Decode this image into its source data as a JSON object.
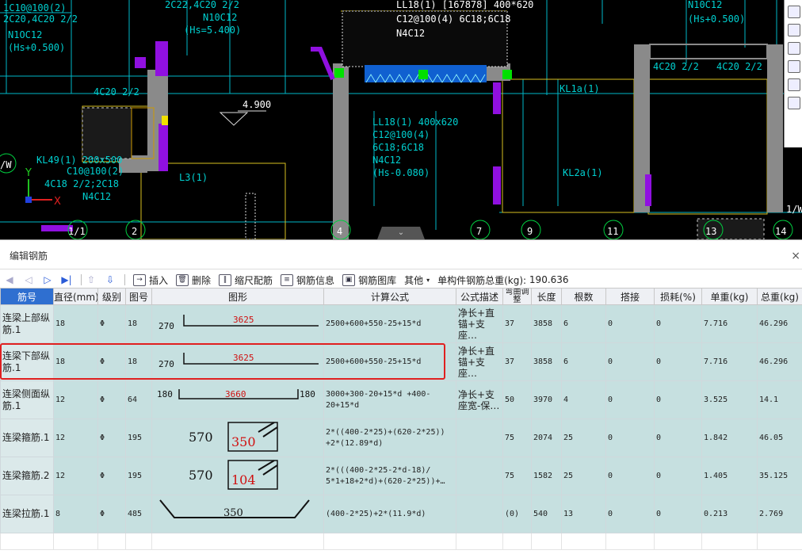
{
  "cad": {
    "annotations": [
      "N10C12",
      "(Hs=5.400)",
      "2C20,4C20 2/2",
      "N1OC12",
      "(Hs+0.500)",
      "LL18(1) [167878] 400*620",
      "C12@100(4) 6C18;6C18",
      "N4C12",
      "N10C12",
      "(Hs+0.500)",
      "4C20 2/2",
      "4C20 2/2",
      "4.900",
      "KL1a(1)",
      "KL49(1) 200x500",
      "C10@100(2)",
      "4C18 2/2;2C18",
      "N4C12",
      "L3(1)",
      "LL18(1) 400x620",
      "C12@100(4)",
      "6C18;6C18",
      "N4C12",
      "(Hs-0.080)",
      "XL1",
      "KL2a(1)",
      "4C22 2/2",
      "1/W",
      "/W"
    ],
    "axis_labels": [
      "1/1",
      "2",
      "4",
      "7",
      "9",
      "11",
      "13",
      "14"
    ],
    "y_axis": "Y",
    "x_axis": "X"
  },
  "panel": {
    "title": "编辑钢筋",
    "close": "×",
    "toolbar": {
      "insert": "插入",
      "delete": "删除",
      "scale_rebar": "缩尺配筋",
      "rebar_info": "钢筋信息",
      "rebar_library": "钢筋图库",
      "other": "其他",
      "total_weight_label": "单构件钢筋总重(kg):",
      "total_weight_value": "190.636"
    },
    "columns": [
      "筋号",
      "直径(mm)",
      "级别",
      "图号",
      "图形",
      "计算公式",
      "公式描述",
      "弯曲调整",
      "长度",
      "根数",
      "搭接",
      "损耗(%)",
      "单重(kg)",
      "总重(kg)"
    ],
    "rows": [
      {
        "name": "连梁上部纵筋.1",
        "dia": "18",
        "grade": "Φ",
        "fig": "18",
        "shape_left": "270",
        "shape_mid": "3625",
        "shape_right": "",
        "formula": "2500+600+550-25+15*d",
        "desc": "净长+直锚+支座…",
        "bend": "37",
        "length": "3858",
        "count": "6",
        "lap": "0",
        "loss": "0",
        "unit_w": "7.716",
        "total_w": "46.296"
      },
      {
        "name": "连梁下部纵筋.1",
        "dia": "18",
        "grade": "Φ",
        "fig": "18",
        "shape_left": "270",
        "shape_mid": "3625",
        "shape_right": "",
        "formula": "2500+600+550-25+15*d",
        "desc": "净长+直锚+支座…",
        "bend": "37",
        "length": "3858",
        "count": "6",
        "lap": "0",
        "loss": "0",
        "unit_w": "7.716",
        "total_w": "46.296"
      },
      {
        "name": "连梁侧面纵筋.1",
        "dia": "12",
        "grade": "Φ",
        "fig": "64",
        "shape_left": "180",
        "shape_mid": "3660",
        "shape_right": "180",
        "formula": "3000+300-20+15*d +400-20+15*d",
        "desc": "净长+支座宽-保…",
        "bend": "50",
        "length": "3970",
        "count": "4",
        "lap": "0",
        "loss": "0",
        "unit_w": "3.525",
        "total_w": "14.1"
      },
      {
        "name": "连梁箍筋.1",
        "dia": "12",
        "grade": "Φ",
        "fig": "195",
        "shape_left": "570",
        "shape_mid": "350",
        "shape_right": "",
        "formula": "2*((400-2*25)+(620-2*25)) +2*(12.89*d)",
        "desc": "",
        "bend": "75",
        "length": "2074",
        "count": "25",
        "lap": "0",
        "loss": "0",
        "unit_w": "1.842",
        "total_w": "46.05"
      },
      {
        "name": "连梁箍筋.2",
        "dia": "12",
        "grade": "Φ",
        "fig": "195",
        "shape_left": "570",
        "shape_mid": "104",
        "shape_right": "",
        "formula": "2*(((400-2*25-2*d-18)/ 5*1+18+2*d)+(620-2*25))+…",
        "desc": "",
        "bend": "75",
        "length": "1582",
        "count": "25",
        "lap": "0",
        "loss": "0",
        "unit_w": "1.405",
        "total_w": "35.125"
      },
      {
        "name": "连梁拉筋.1",
        "dia": "8",
        "grade": "Φ",
        "fig": "485",
        "shape_left": "",
        "shape_mid": "350",
        "shape_right": "",
        "formula": "(400-2*25)+2*(11.9*d)",
        "desc": "",
        "bend": "(0)",
        "length": "540",
        "count": "13",
        "lap": "0",
        "loss": "0",
        "unit_w": "0.213",
        "total_w": "2.769"
      }
    ]
  }
}
